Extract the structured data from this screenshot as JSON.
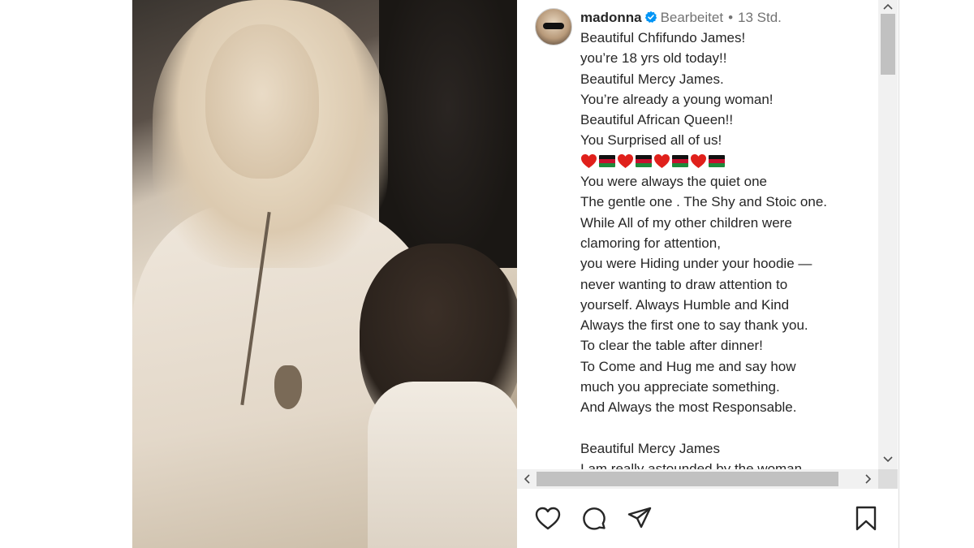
{
  "post": {
    "username": "madonna",
    "edited_label": "Bearbeitet",
    "separator": "•",
    "time": "13 Std.",
    "caption_lines_top": [
      "Beautiful Chfifundo James!",
      "you’re 18 yrs old today!!",
      "Beautiful Mercy James.",
      "You’re already a young woman!",
      "Beautiful African Queen!!",
      "You Surprised all of us!"
    ],
    "emoji_sequence": [
      "heart",
      "flag-malawi",
      "heart",
      "flag-malawi",
      "heart",
      "flag-malawi",
      "heart",
      "flag-malawi"
    ],
    "caption_lines_bottom": [
      "You were always the quiet one",
      "The gentle one . The Shy and Stoic one.",
      "While All of my other children were",
      "clamoring for attention,",
      "you were Hiding under your hoodie —",
      "never wanting to draw attention to",
      "yourself. Always Humble and Kind",
      "Always the first one to say thank you.",
      "To clear the table after dinner!",
      "To Come and Hug me and say how",
      "much you appreciate something.",
      "And Always the most Responsable.",
      "",
      "Beautiful Mercy James",
      "I am really astounded by the woman"
    ]
  },
  "actions": {
    "like": "heart-icon",
    "comment": "comment-icon",
    "share": "share-icon",
    "save": "bookmark-icon"
  },
  "colors": {
    "text": "#262626",
    "muted": "#737373",
    "verified": "#0095f6",
    "heart_emoji": "#e0201b"
  }
}
